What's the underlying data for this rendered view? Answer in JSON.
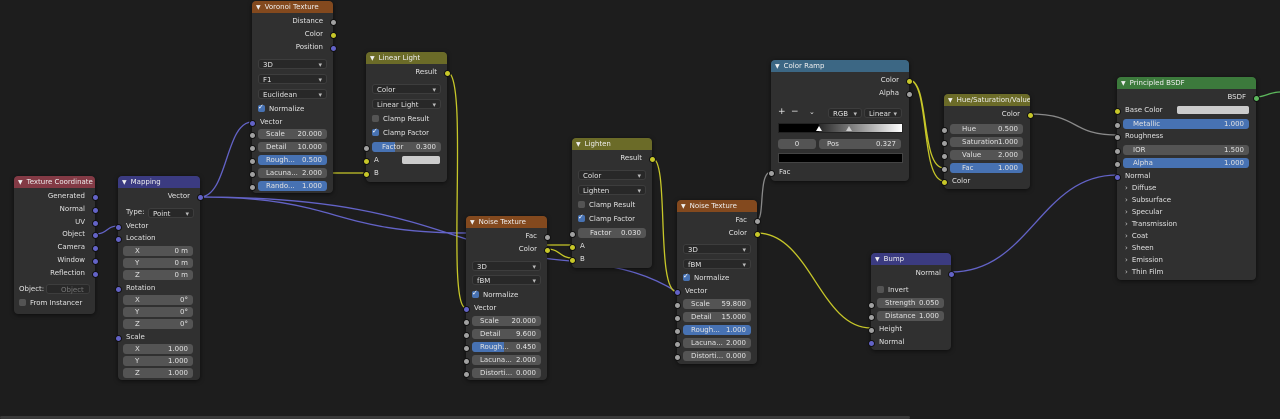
{
  "nodes": {
    "texcoord": {
      "title": "Texture Coordinate",
      "color": "#833a45",
      "outputs": [
        "Generated",
        "Normal",
        "UV",
        "Object",
        "Camera",
        "Window",
        "Reflection"
      ],
      "object_label": "Object:",
      "object_placeholder": "Object",
      "from_instancer": "From Instancer"
    },
    "mapping": {
      "title": "Mapping",
      "color": "#3b3b81",
      "output": "Vector",
      "type_label": "Type:",
      "type_value": "Point",
      "vector_label": "Vector",
      "location_label": "Location",
      "location": [
        {
          "l": "X",
          "v": "0 m"
        },
        {
          "l": "Y",
          "v": "0 m"
        },
        {
          "l": "Z",
          "v": "0 m"
        }
      ],
      "rotation_label": "Rotation",
      "rotation": [
        {
          "l": "X",
          "v": "0°"
        },
        {
          "l": "Y",
          "v": "0°"
        },
        {
          "l": "Z",
          "v": "0°"
        }
      ],
      "scale_label": "Scale",
      "scale": [
        {
          "l": "X",
          "v": "1.000"
        },
        {
          "l": "Y",
          "v": "1.000"
        },
        {
          "l": "Z",
          "v": "1.000"
        }
      ]
    },
    "voronoi": {
      "title": "Voronoi Texture",
      "color": "#83491e",
      "outputs": [
        "Distance",
        "Color",
        "Position"
      ],
      "dim": "3D",
      "feature": "F1",
      "metric": "Euclidean",
      "normalize": "Normalize",
      "vector_label": "Vector",
      "fields": [
        {
          "l": "Scale",
          "v": "20.000"
        },
        {
          "l": "Detail",
          "v": "10.000"
        },
        {
          "l": "Rough...",
          "v": "0.500"
        },
        {
          "l": "Lacuna...",
          "v": "2.000"
        },
        {
          "l": "Rando...",
          "v": "1.000"
        }
      ]
    },
    "linear": {
      "title": "Linear Light",
      "color": "#6b6b28",
      "output": "Result",
      "type": "Color",
      "blend": "Linear Light",
      "clamp_result": "Clamp Result",
      "clamp_factor": "Clamp Factor",
      "factor_label": "Factor",
      "factor_value": "0.300",
      "a": "A",
      "b": "B"
    },
    "noise1": {
      "title": "Noise Texture",
      "color": "#83491e",
      "outputs": [
        "Fac",
        "Color"
      ],
      "dim": "3D",
      "type": "fBM",
      "normalize": "Normalize",
      "vector_label": "Vector",
      "fields": [
        {
          "l": "Scale",
          "v": "20.000"
        },
        {
          "l": "Detail",
          "v": "9.600"
        },
        {
          "l": "Rough...",
          "v": "0.450"
        },
        {
          "l": "Lacuna...",
          "v": "2.000"
        },
        {
          "l": "Distorti...",
          "v": "0.000"
        }
      ]
    },
    "lighten": {
      "title": "Lighten",
      "color": "#6b6b28",
      "output": "Result",
      "type": "Color",
      "blend": "Lighten",
      "clamp_result": "Clamp Result",
      "clamp_factor": "Clamp Factor",
      "factor_label": "Factor",
      "factor_value": "0.030",
      "a": "A",
      "b": "B"
    },
    "noise2": {
      "title": "Noise Texture",
      "color": "#83491e",
      "outputs": [
        "Fac",
        "Color"
      ],
      "dim": "3D",
      "type": "fBM",
      "normalize": "Normalize",
      "vector_label": "Vector",
      "fields": [
        {
          "l": "Scale",
          "v": "59.800"
        },
        {
          "l": "Detail",
          "v": "15.000"
        },
        {
          "l": "Rough...",
          "v": "1.000"
        },
        {
          "l": "Lacuna...",
          "v": "2.000"
        },
        {
          "l": "Distorti...",
          "v": "0.000"
        }
      ]
    },
    "ramp": {
      "title": "Color Ramp",
      "color": "#3c6784",
      "outputs": [
        "Color",
        "Alpha"
      ],
      "add": "+",
      "remove": "−",
      "mode": "RGB",
      "interp": "Linear",
      "index": "0",
      "pos_label": "Pos",
      "pos_value": "0.327",
      "fac": "Fac"
    },
    "hsv": {
      "title": "Hue/Saturation/Value",
      "color": "#6b6b28",
      "output": "Color",
      "fields": [
        {
          "l": "Hue",
          "v": "0.500"
        },
        {
          "l": "Saturation",
          "v": "1.000"
        },
        {
          "l": "Value",
          "v": "2.000"
        },
        {
          "l": "Fac",
          "v": "1.000"
        }
      ],
      "color_in": "Color"
    },
    "bump": {
      "title": "Bump",
      "color": "#3b3b81",
      "output": "Normal",
      "invert": "Invert",
      "fields": [
        {
          "l": "Strength",
          "v": "0.050"
        },
        {
          "l": "Distance",
          "v": "1.000"
        }
      ],
      "height": "Height",
      "normal": "Normal"
    },
    "bsdf": {
      "title": "Principled BSDF",
      "color": "#3c7a3c",
      "output": "BSDF",
      "base_color": "Base Color",
      "metallic_label": "Metallic",
      "metallic_value": "1.000",
      "roughness": "Roughness",
      "ior_label": "IOR",
      "ior_value": "1.500",
      "alpha_label": "Alpha",
      "alpha_value": "1.000",
      "normal": "Normal",
      "groups": [
        "Diffuse",
        "Subsurface",
        "Specular",
        "Transmission",
        "Coat",
        "Sheen",
        "Emission",
        "Thin Film"
      ]
    }
  },
  "colors": {
    "wire_gray": "#8a8a8a",
    "wire_yellow": "#c7c729",
    "wire_purple": "#6363c7",
    "accent": "#4772b3"
  }
}
